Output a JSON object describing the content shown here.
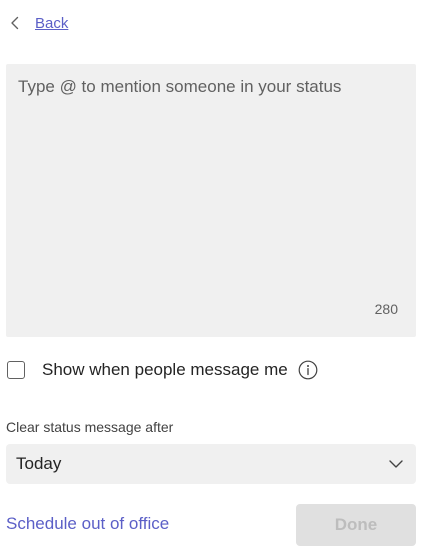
{
  "header": {
    "back_label": "Back",
    "back_icon": "chevron-left-icon"
  },
  "status": {
    "placeholder": "Type @ to mention someone in your status",
    "value": "",
    "char_count": "280"
  },
  "options": {
    "show_when_messaged_label": "Show when people message me",
    "show_when_messaged_checked": false,
    "info_icon": "info-icon"
  },
  "clear_after": {
    "label": "Clear status message after",
    "selected": "Today",
    "chevron_icon": "chevron-down-icon"
  },
  "footer": {
    "schedule_label": "Schedule out of office",
    "done_label": "Done",
    "done_enabled": false
  },
  "colors": {
    "link": "#5b5fc7",
    "field_background": "#f0f0f0",
    "disabled_button": "#e0e0e0",
    "disabled_text": "#bdbdbd"
  }
}
